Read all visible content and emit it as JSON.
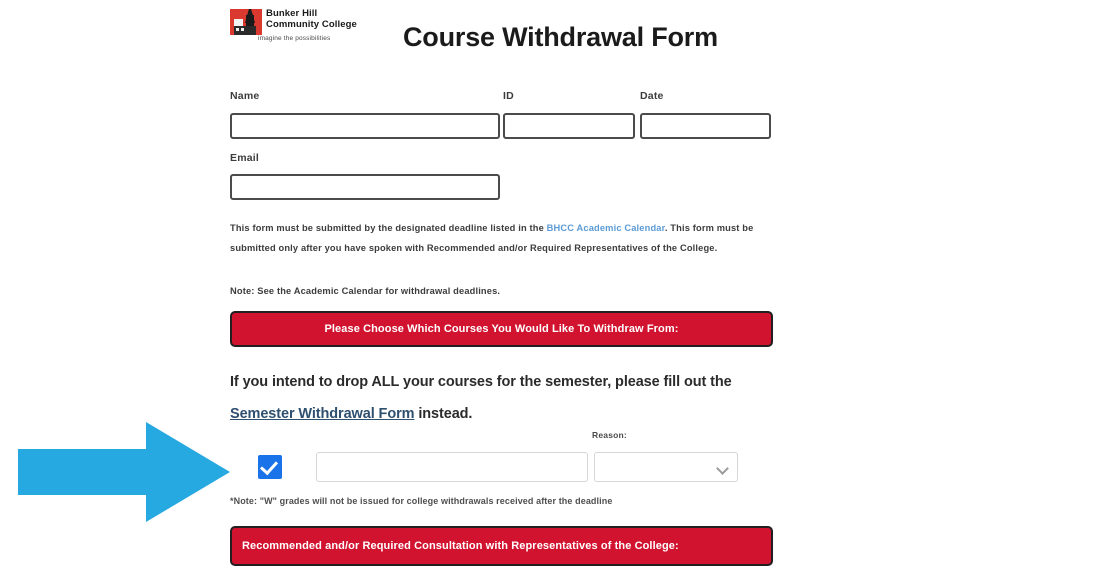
{
  "document": {
    "title": "Course Withdrawal Form"
  },
  "logo": {
    "name_line1": "Bunker Hill",
    "name_line2": "Community College",
    "tagline": "imagine the possibilities",
    "mark_color": "#d9392f"
  },
  "fields": {
    "name": {
      "label": "Name",
      "value": "",
      "placeholder": ""
    },
    "id": {
      "label": "ID",
      "value": "",
      "placeholder": ""
    },
    "date": {
      "label": "Date",
      "value": "",
      "placeholder": ""
    },
    "email": {
      "label": "Email",
      "value": "",
      "placeholder": ""
    }
  },
  "instructions": {
    "part1": "This form must be submitted by the designated deadline listed in the ",
    "link_text": "BHCC Academic Calendar",
    "part2": ". This form must be submitted only after you have spoken with Recommended and/or Required Representatives of the College.",
    "note": "Note: See the Academic Calendar for withdrawal deadlines.",
    "link_color": "#5b9bd5"
  },
  "banners": {
    "choose_courses": "Please Choose Which Courses You Would Like To Withdraw From:",
    "consultation": "Recommended and/or Required Consultation with Representatives of the College:",
    "background_color": "#d1132f",
    "border_color": "#231f20"
  },
  "drop_all_notice": {
    "part1": "If you intend to drop ALL your courses for the semester, please fill out the ",
    "link_text": "Semester Withdrawal Form",
    "part2": " instead.",
    "link_color": "#2f4f6f"
  },
  "course_row": {
    "checkbox_checked": true,
    "checkbox_color": "#1a73e8",
    "course_value": "",
    "course_placeholder": "",
    "reason_label": "Reason:",
    "reason_selected": "",
    "reason_options": [
      ""
    ]
  },
  "notes": {
    "w_grades": "*Note: \"W\" grades will not be issued for college withdrawals received after the deadline"
  },
  "annotation": {
    "arrow_color": "#26a9e0",
    "direction": "right"
  }
}
